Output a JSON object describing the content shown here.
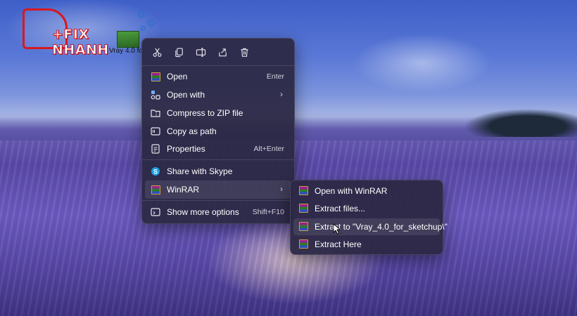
{
  "desktop": {
    "watermark_text": "+FIX NHANH",
    "file_label": "Vray 4.0 fo"
  },
  "toolbar": {
    "icons": [
      "cut-icon",
      "copy-icon",
      "rename-icon",
      "share-icon",
      "delete-icon"
    ]
  },
  "menu": {
    "items": [
      {
        "label": "Open",
        "shortcut": "Enter",
        "icon": "winrar-icon"
      },
      {
        "label": "Open with",
        "shortcut": "",
        "icon": "open-with-icon",
        "submenu": true
      },
      {
        "label": "Compress to ZIP file",
        "shortcut": "",
        "icon": "zip-folder-icon"
      },
      {
        "label": "Copy as path",
        "shortcut": "",
        "icon": "copy-path-icon"
      },
      {
        "label": "Properties",
        "shortcut": "Alt+Enter",
        "icon": "properties-icon"
      },
      {
        "label": "Share with Skype",
        "shortcut": "",
        "icon": "skype-icon"
      },
      {
        "label": "WinRAR",
        "shortcut": "",
        "icon": "winrar-icon",
        "submenu": true
      },
      {
        "label": "Show more options",
        "shortcut": "Shift+F10",
        "icon": "more-options-icon"
      }
    ],
    "arrow": "›"
  },
  "submenu": {
    "items": [
      {
        "label": "Open with WinRAR"
      },
      {
        "label": "Extract files..."
      },
      {
        "label": "Extract to \"Vray_4.0_for_sketchup\\\""
      },
      {
        "label": "Extract Here"
      }
    ]
  },
  "colors": {
    "menu_bg": "#2c2844",
    "logo_red": "#d8181f",
    "text": "#ffffff"
  }
}
